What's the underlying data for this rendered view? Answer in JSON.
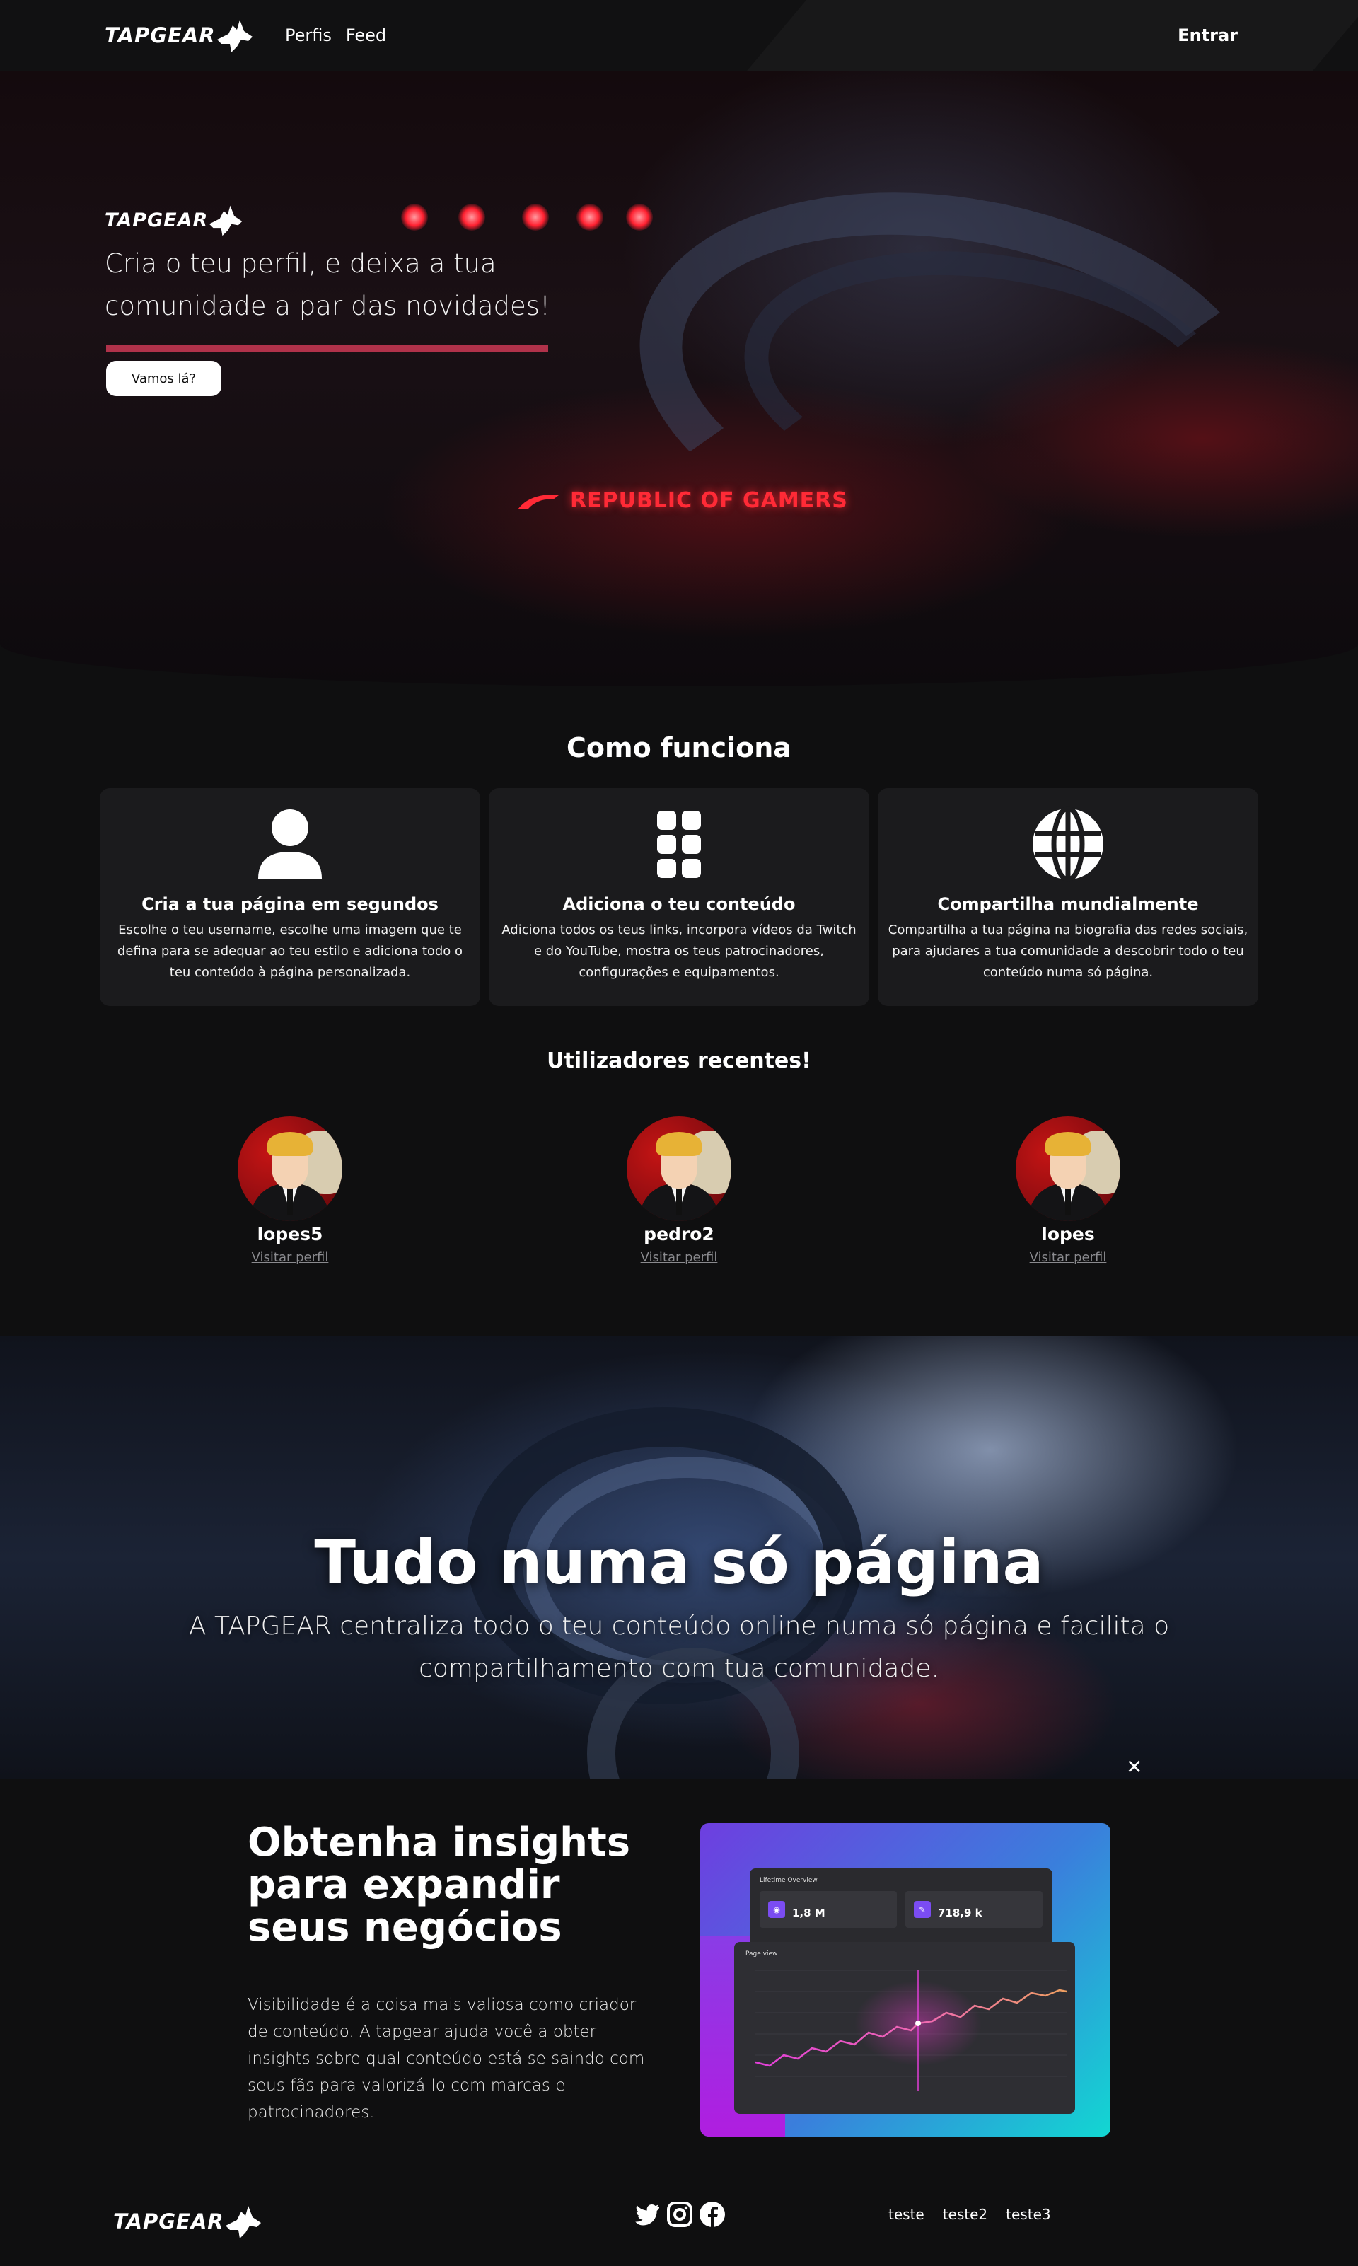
{
  "brand": {
    "name": "TAPGEAR"
  },
  "nav": {
    "links": [
      "Perfis",
      "Feed"
    ],
    "login": "Entrar"
  },
  "hero": {
    "tagline": "Cria o teu perfil, e deixa a tua comunidade a par das novidades!",
    "cta": "Vamos lá?",
    "image_text": "REPUBLIC OF GAMERS"
  },
  "how": {
    "title": "Como funciona",
    "cards": [
      {
        "icon": "user-icon",
        "title": "Cria a tua página em segundos",
        "text": "Escolhe o teu username, escolhe uma imagem que te defina para se adequar ao teu estilo e adiciona todo o teu conteúdo à página personalizada."
      },
      {
        "icon": "grid-icon",
        "title": "Adiciona o teu conteúdo",
        "text": "Adiciona todos os teus links, incorpora vídeos da Twitch e do YouTube, mostra os teus patrocinadores, configurações e equipamentos."
      },
      {
        "icon": "globe-icon",
        "title": "Compartilha mundialmente",
        "text": "Compartilha a tua página na biografia das redes sociais, para ajudares a tua comunidade a descobrir todo o teu conteúdo numa só página."
      }
    ]
  },
  "recent": {
    "title": "Utilizadores recentes!",
    "users": [
      {
        "name": "lopes5",
        "link": "Visitar perfil"
      },
      {
        "name": "pedro2",
        "link": "Visitar perfil"
      },
      {
        "name": "lopes",
        "link": "Visitar perfil"
      }
    ]
  },
  "banner": {
    "title": "Tudo numa só página",
    "text": "A TAPGEAR centraliza todo o teu conteúdo online numa só página e facilita o compartilhamento com tua comunidade."
  },
  "insights": {
    "title": "Obtenha insights para expandir seus negócios",
    "text": "Visibilidade é a coisa mais valiosa como criador de conteúdo. A tapgear ajuda você a obter insights sobre qual conteúdo está se saindo com seus fãs para valorizá-lo com marcas e patrocinadores.",
    "mockup": {
      "overview_title": "Lifetime Overview",
      "stats": [
        {
          "value": "1,8 M"
        },
        {
          "value": "718,9 k"
        }
      ],
      "chart_title": "Page view"
    }
  },
  "footer": {
    "social": [
      "twitter-icon",
      "instagram-icon",
      "facebook-icon"
    ],
    "links": [
      "teste",
      "teste2",
      "teste3"
    ]
  },
  "colors": {
    "accent": "#b0324a",
    "background": "#0f0f10",
    "card": "#1b1b1d"
  }
}
